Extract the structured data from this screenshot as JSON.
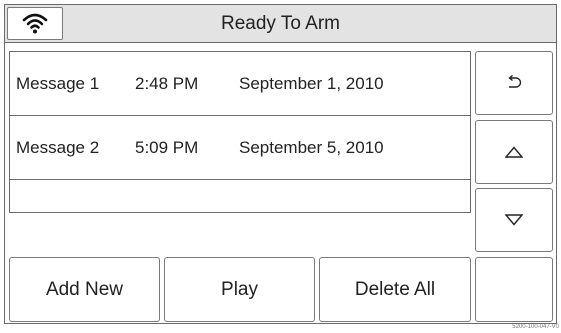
{
  "header": {
    "title": "Ready To Arm",
    "status_icon": "wifi-icon"
  },
  "messages": [
    {
      "name": "Message 1",
      "time": "2:48 PM",
      "date": "September 1, 2010"
    },
    {
      "name": "Message 2",
      "time": "5:09 PM",
      "date": "September 5, 2010"
    }
  ],
  "side_buttons": {
    "back_icon": "back-arrow-icon",
    "up_icon": "up-triangle-icon",
    "down_icon": "down-triangle-icon"
  },
  "bottom_buttons": {
    "add_new": "Add New",
    "play": "Play",
    "delete_all": "Delete All"
  },
  "footer": {
    "code": "5200-100-047-V0"
  }
}
